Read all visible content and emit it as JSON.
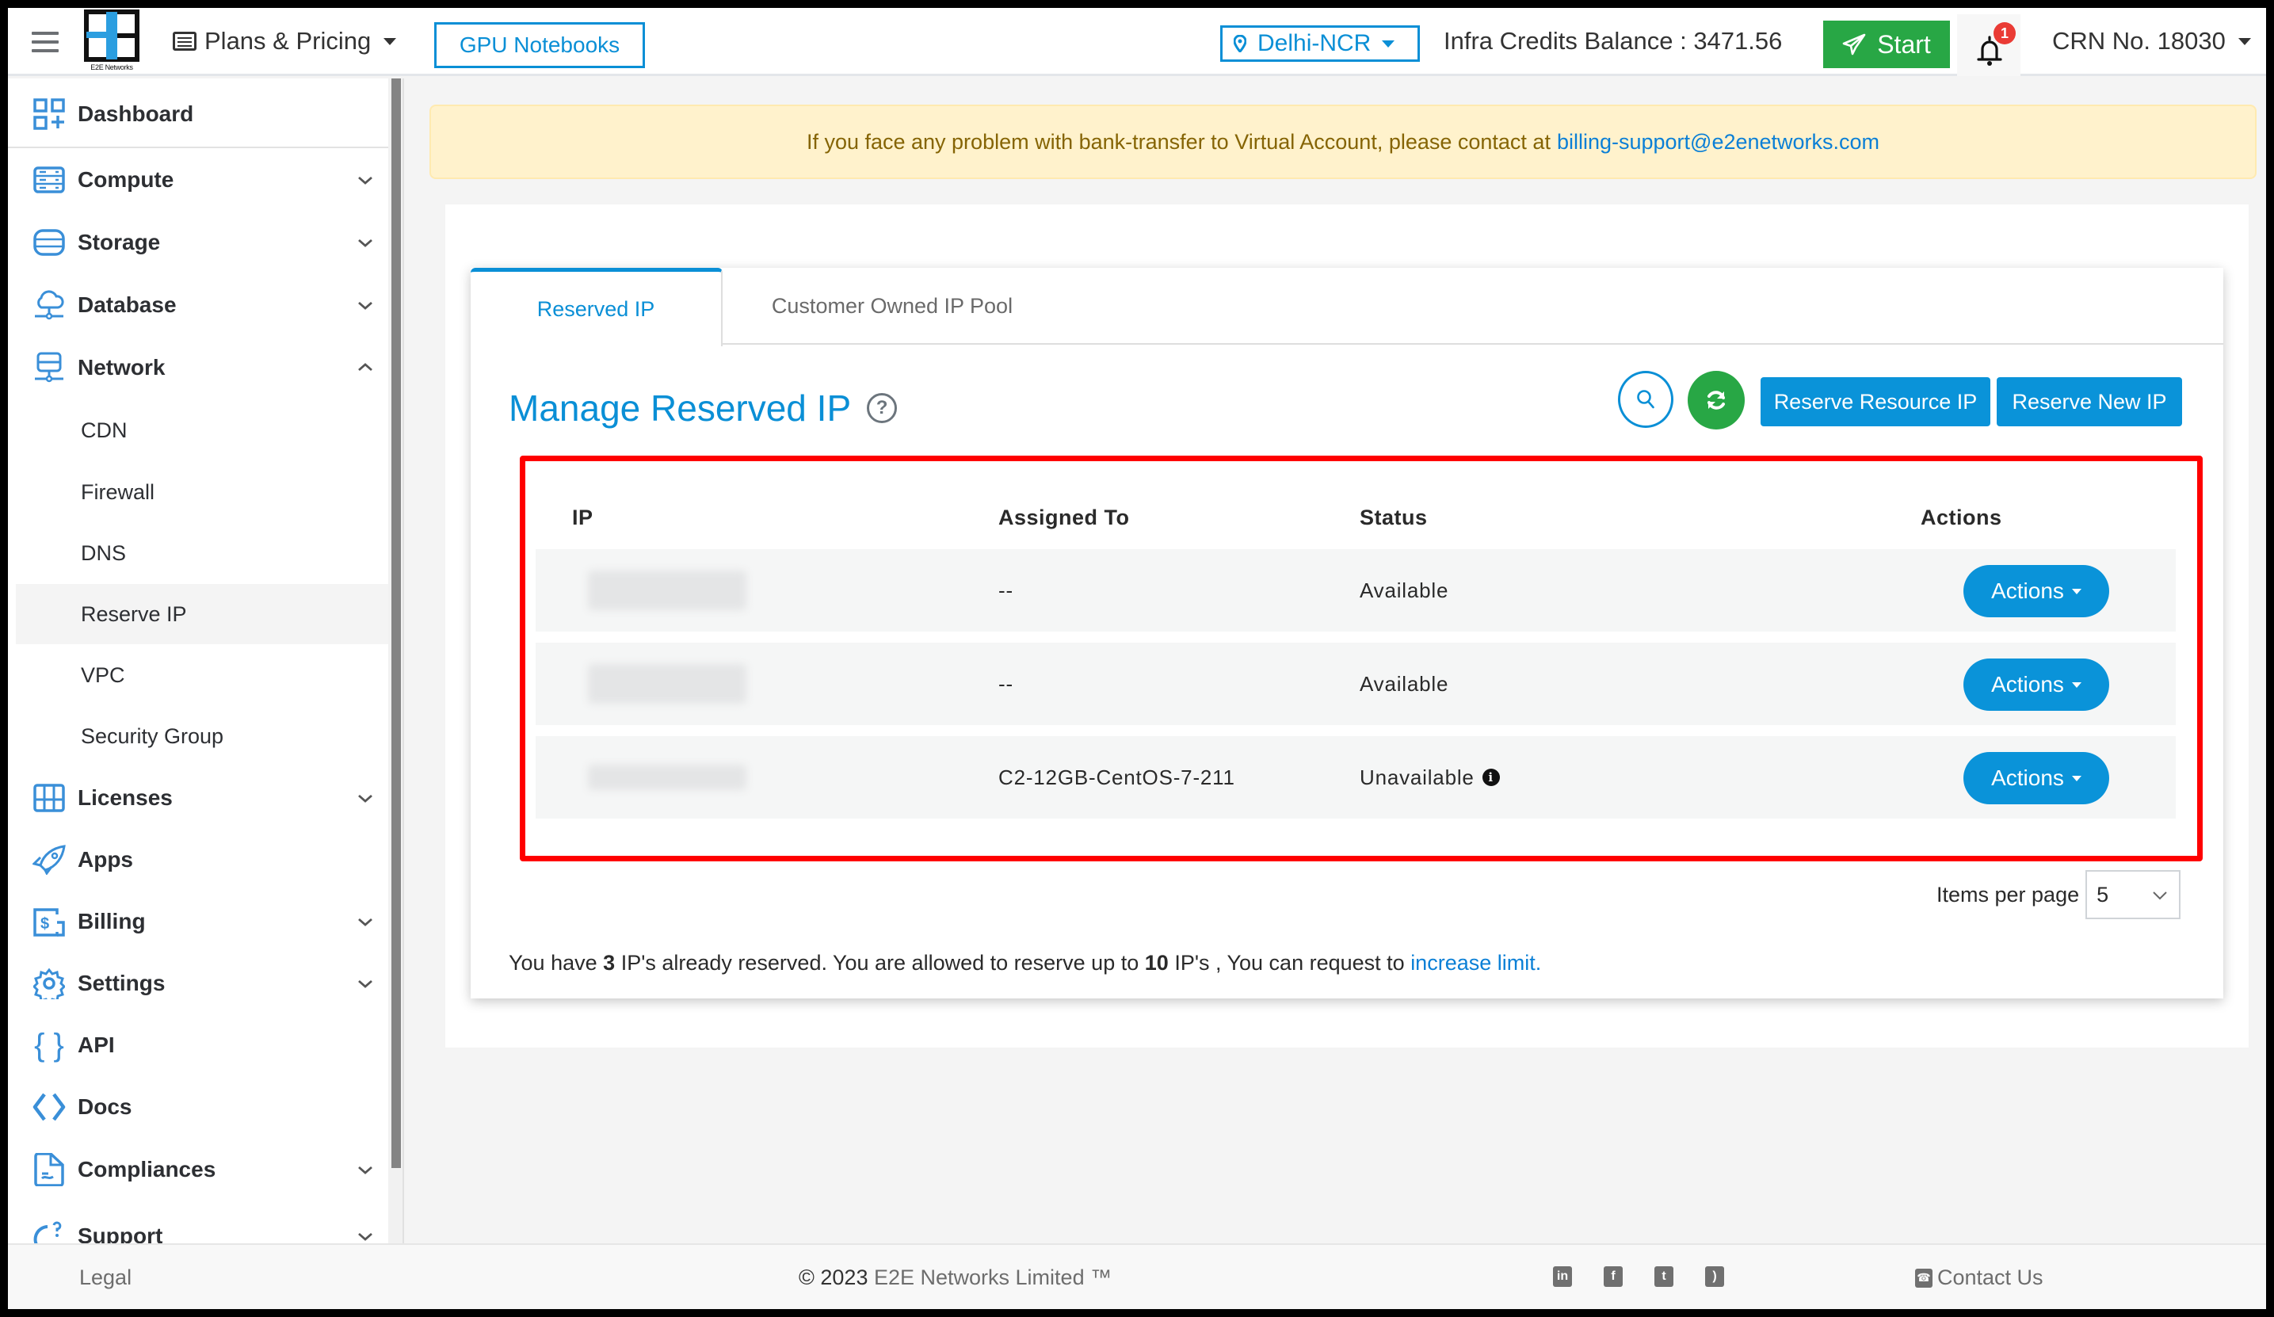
{
  "topbar": {
    "logo_text": "E2E Networks",
    "plans_label": "Plans & Pricing",
    "gpu_notebooks_label": "GPU Notebooks",
    "region_label": "Delhi-NCR",
    "credits_label": "Infra Credits Balance : 3471.56",
    "start_label": "Start",
    "notification_count": "1",
    "crn_label": "CRN No. 18030"
  },
  "sidebar": {
    "items": [
      {
        "label": "Dashboard",
        "icon": "dashboard-icon",
        "expandable": false
      },
      {
        "label": "Compute",
        "icon": "server-icon",
        "expandable": true
      },
      {
        "label": "Storage",
        "icon": "storage-icon",
        "expandable": true
      },
      {
        "label": "Database",
        "icon": "cloud-database-icon",
        "expandable": true
      },
      {
        "label": "Network",
        "icon": "network-icon",
        "expandable": true,
        "expanded": true
      },
      {
        "label": "Licenses",
        "icon": "licenses-icon",
        "expandable": true
      },
      {
        "label": "Apps",
        "icon": "rocket-icon",
        "expandable": false
      },
      {
        "label": "Billing",
        "icon": "billing-icon",
        "expandable": true
      },
      {
        "label": "Settings",
        "icon": "gear-icon",
        "expandable": true
      },
      {
        "label": "API",
        "icon": "braces-icon",
        "expandable": false
      },
      {
        "label": "Docs",
        "icon": "code-icon",
        "expandable": false
      },
      {
        "label": "Compliances",
        "icon": "document-icon",
        "expandable": true
      },
      {
        "label": "Support",
        "icon": "support-icon",
        "expandable": true
      }
    ],
    "network_subitems": [
      {
        "label": "CDN"
      },
      {
        "label": "Firewall"
      },
      {
        "label": "DNS"
      },
      {
        "label": "Reserve IP",
        "active": true
      },
      {
        "label": "VPC"
      },
      {
        "label": "Security Group"
      }
    ]
  },
  "alert": {
    "text": "If you face any problem with bank-transfer to Virtual Account, please contact at",
    "email": "billing-support@e2enetworks.com"
  },
  "tabs": [
    {
      "label": "Reserved IP",
      "active": true
    },
    {
      "label": "Customer Owned IP Pool",
      "active": false
    }
  ],
  "page": {
    "title": "Manage Reserved IP",
    "reserve_resource_ip_label": "Reserve Resource IP",
    "reserve_new_ip_label": "Reserve New IP"
  },
  "table": {
    "columns": [
      "IP",
      "Assigned To",
      "Status",
      "Actions"
    ],
    "rows": [
      {
        "ip": "[blurred]",
        "assigned_to": "--",
        "status": "Available",
        "status_info": false,
        "action_label": "Actions"
      },
      {
        "ip": "[blurred]",
        "assigned_to": "--",
        "status": "Available",
        "status_info": false,
        "action_label": "Actions"
      },
      {
        "ip": "[blurred]",
        "assigned_to": "C2-12GB-CentOS-7-211",
        "status": "Unavailable",
        "status_info": true,
        "action_label": "Actions"
      }
    ]
  },
  "pagination": {
    "items_per_page_label": "Items per page",
    "items_per_page_value": "5"
  },
  "limit": {
    "prefix": "You have",
    "reserved_count": "3",
    "middle": "IP's already reserved. You are allowed to reserve up to",
    "max_count": "10",
    "suffix": "IP's , You can request to",
    "link_label": "increase limit."
  },
  "footer": {
    "legal_label": "Legal",
    "copyright_symbol_year": "© 2023",
    "company": "E2E Networks Limited ™",
    "social": [
      "linkedin-icon",
      "facebook-icon",
      "twitter-icon",
      "rss-icon"
    ],
    "contact_label": "Contact Us"
  },
  "colors": {
    "brand_blue": "#0a8fd6",
    "start_green": "#28a745",
    "highlight_red": "#ff0000",
    "alert_bg": "#fff2cc",
    "badge_red": "#ea3b35"
  }
}
